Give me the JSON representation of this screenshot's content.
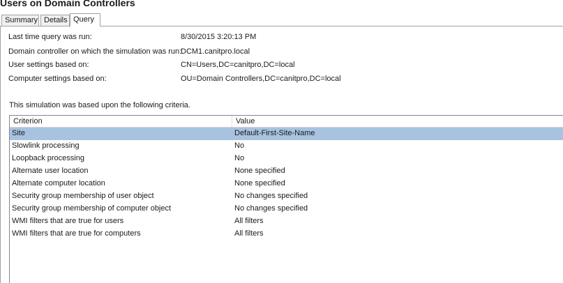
{
  "window": {
    "title": "Users on Domain Controllers"
  },
  "tabs": [
    {
      "label": "Summary",
      "active": false
    },
    {
      "label": "Details",
      "active": false
    },
    {
      "label": "Query",
      "active": true
    }
  ],
  "query_info": [
    {
      "label": "Last time query was run:",
      "value": "8/30/2015 3:20:13 PM"
    },
    {
      "label": "Domain controller on which the simulation was run:",
      "value": "DCM1.canitpro.local"
    },
    {
      "label": "User settings based on:",
      "value": "CN=Users,DC=canitpro,DC=local"
    },
    {
      "label": "Computer settings based on:",
      "value": "OU=Domain Controllers,DC=canitpro,DC=local"
    }
  ],
  "criteria_intro": "This simulation was based upon the following criteria.",
  "table": {
    "columns": [
      "Criterion",
      "Value"
    ],
    "rows": [
      {
        "criterion": "Site",
        "value": "Default-First-Site-Name",
        "selected": true
      },
      {
        "criterion": "Slowlink processing",
        "value": "No",
        "selected": false
      },
      {
        "criterion": "Loopback processing",
        "value": "No",
        "selected": false
      },
      {
        "criterion": "Alternate user location",
        "value": "None specified",
        "selected": false
      },
      {
        "criterion": "Alternate computer location",
        "value": "None specified",
        "selected": false
      },
      {
        "criterion": "Security group membership of user object",
        "value": "No changes specified",
        "selected": false
      },
      {
        "criterion": "Security group membership of computer object",
        "value": "No changes specified",
        "selected": false
      },
      {
        "criterion": "WMI filters that are true for users",
        "value": "All filters",
        "selected": false
      },
      {
        "criterion": "WMI filters that are true for computers",
        "value": "All filters",
        "selected": false
      }
    ]
  },
  "colors": {
    "selection": "#a7c3e0",
    "border": "#a0a0a0",
    "tab_inactive": "#f0f0f0"
  }
}
